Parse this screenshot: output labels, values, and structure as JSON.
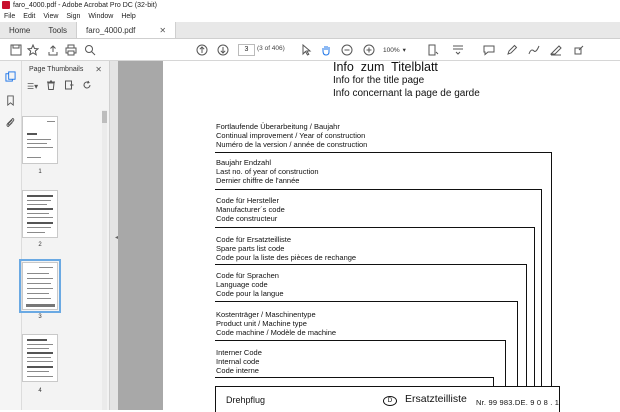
{
  "window": {
    "title": "faro_4000.pdf - Adobe Acrobat Pro DC (32-bit)"
  },
  "menu": [
    "File",
    "Edit",
    "View",
    "Sign",
    "Window",
    "Help"
  ],
  "tabs": {
    "home": "Home",
    "tools": "Tools",
    "document": "faro_4000.pdf"
  },
  "toolbar": {
    "page_current": "3",
    "page_of": "(3 of 406)",
    "zoom": "100%"
  },
  "thumbnails": {
    "title": "Page Thumbnails",
    "pages": [
      "1",
      "2",
      "3",
      "4"
    ],
    "selected": "3"
  },
  "icons": {
    "save": "save-icon",
    "star": "star-icon",
    "upload": "upload-icon",
    "print": "print-icon",
    "search": "search-icon",
    "prev": "prev-page-icon",
    "next": "next-page-icon",
    "hand": "hand-tool-icon",
    "zoom_out": "zoom-out-icon",
    "zoom_in": "zoom-in-icon"
  },
  "document": {
    "title": "Info  zum  Titelblatt",
    "subtitle_en": "Info for the title page",
    "subtitle_fr": "Info concernant la page de garde",
    "items": [
      {
        "de": "Fortlaufende Überarbeitung / Baujahr",
        "en": "Continual improvement / Year of construction",
        "fr": "Numéro de la version / année de construction"
      },
      {
        "de": "Baujahr Endzahl",
        "en": "Last no. of year of construction",
        "fr": "Dernier chiffre de l'année"
      },
      {
        "de": "Code für Hersteller",
        "en": "Manufacturer´s  code",
        "fr": "Code constructeur"
      },
      {
        "de": "Code für Ersatzteilliste",
        "en": "Spare parts list code",
        "fr": "Code pour la liste des pièces de rechange"
      },
      {
        "de": "Code für Sprachen",
        "en": "Language code",
        "fr": "Code pour la langue"
      },
      {
        "de": "Kostenträger / Maschinentype",
        "en": "Product unit / Machine type",
        "fr": "Code machine / Modèle de machine"
      },
      {
        "de": "Interner Code",
        "en": "Internal code",
        "fr": "Code interne"
      }
    ],
    "box": {
      "left": "Drehpflug",
      "circle": "D",
      "title": "Ersatzteilliste",
      "number": "Nr. 99 983.DE. 9 0 8 . 1"
    }
  },
  "colors": {
    "accent": "#1a73e8",
    "pdf_red": "#c8102e",
    "canvas": "#a8a8a8"
  }
}
